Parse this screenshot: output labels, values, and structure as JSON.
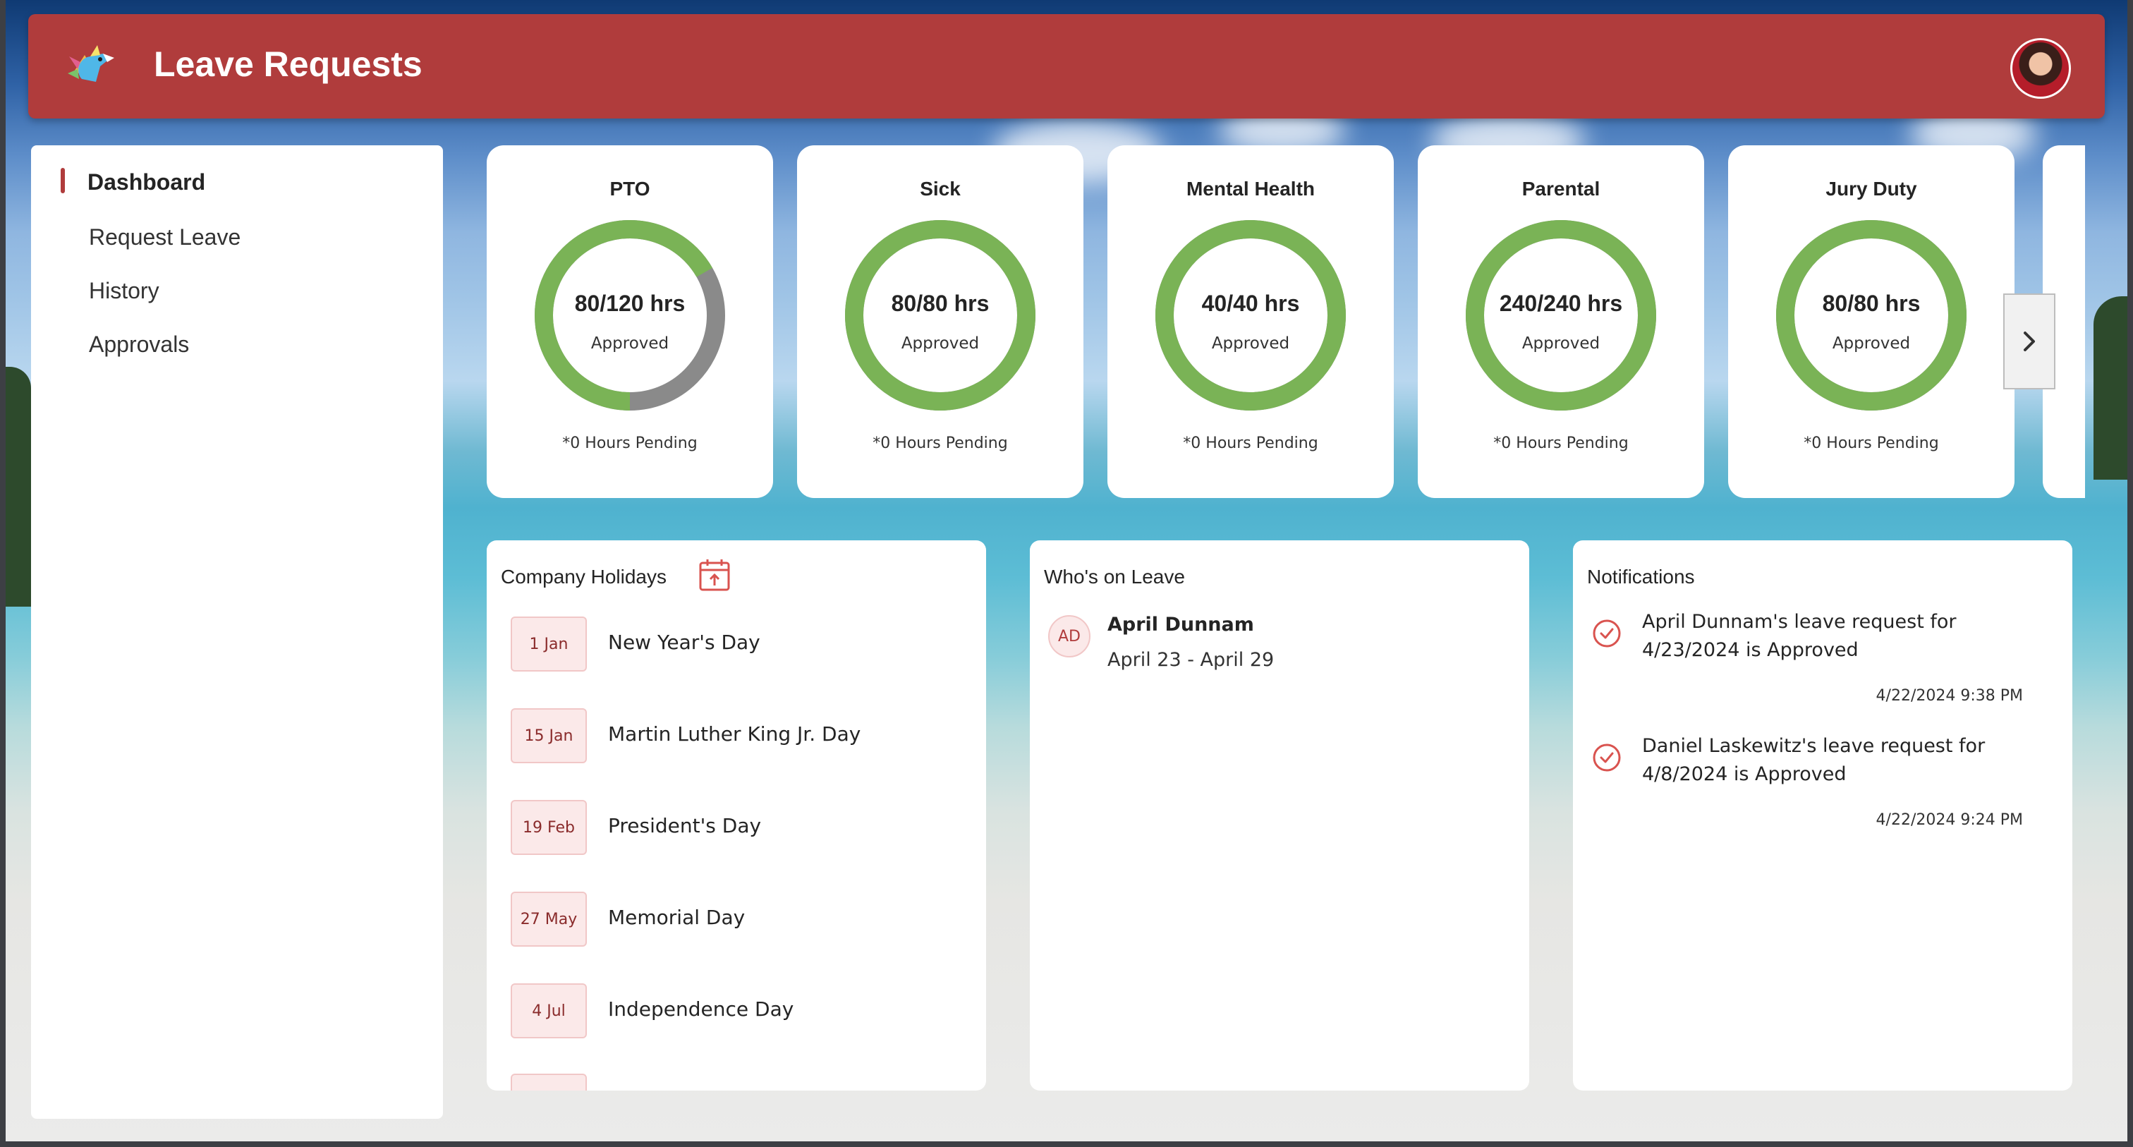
{
  "app": {
    "title": "Leave Requests"
  },
  "sidebar": {
    "items": [
      {
        "label": "Dashboard",
        "active": true
      },
      {
        "label": "Request Leave"
      },
      {
        "label": "History"
      },
      {
        "label": "Approvals"
      }
    ]
  },
  "leave_cards": [
    {
      "title": "PTO",
      "hours": "80/120 hrs",
      "status": "Approved",
      "pending": "*0 Hours Pending",
      "used": 80,
      "total": 120
    },
    {
      "title": "Sick",
      "hours": "80/80 hrs",
      "status": "Approved",
      "pending": "*0 Hours Pending",
      "used": 80,
      "total": 80
    },
    {
      "title": "Mental Health",
      "hours": "40/40 hrs",
      "status": "Approved",
      "pending": "*0 Hours Pending",
      "used": 40,
      "total": 40
    },
    {
      "title": "Parental",
      "hours": "240/240 hrs",
      "status": "Approved",
      "pending": "*0 Hours Pending",
      "used": 240,
      "total": 240
    },
    {
      "title": "Jury Duty",
      "hours": "80/80 hrs",
      "status": "Approved",
      "pending": "*0 Hours Pending",
      "used": 80,
      "total": 80
    }
  ],
  "holidays": {
    "title": "Company Holidays",
    "items": [
      {
        "date": "1 Jan",
        "name": "New Year's Day"
      },
      {
        "date": "15 Jan",
        "name": "Martin Luther King Jr. Day"
      },
      {
        "date": "19 Feb",
        "name": "President's Day"
      },
      {
        "date": "27 May",
        "name": "Memorial Day"
      },
      {
        "date": "4 Jul",
        "name": "Independence Day"
      }
    ]
  },
  "on_leave": {
    "title": "Who's on Leave",
    "people": [
      {
        "initials": "AD",
        "name": "April Dunnam",
        "dates": "April 23 - April 29"
      }
    ]
  },
  "notifications": {
    "title": "Notifications",
    "items": [
      {
        "text": "April Dunnam's leave request for 4/23/2024 is Approved",
        "time": "4/22/2024 9:38 PM"
      },
      {
        "text": "Daniel Laskewitz's leave request for 4/8/2024 is Approved",
        "time": "4/22/2024 9:24 PM"
      }
    ]
  },
  "colors": {
    "header": "#b03c3c",
    "donut_used": "#7ab356",
    "donut_remaining": "#8a8a8a"
  }
}
